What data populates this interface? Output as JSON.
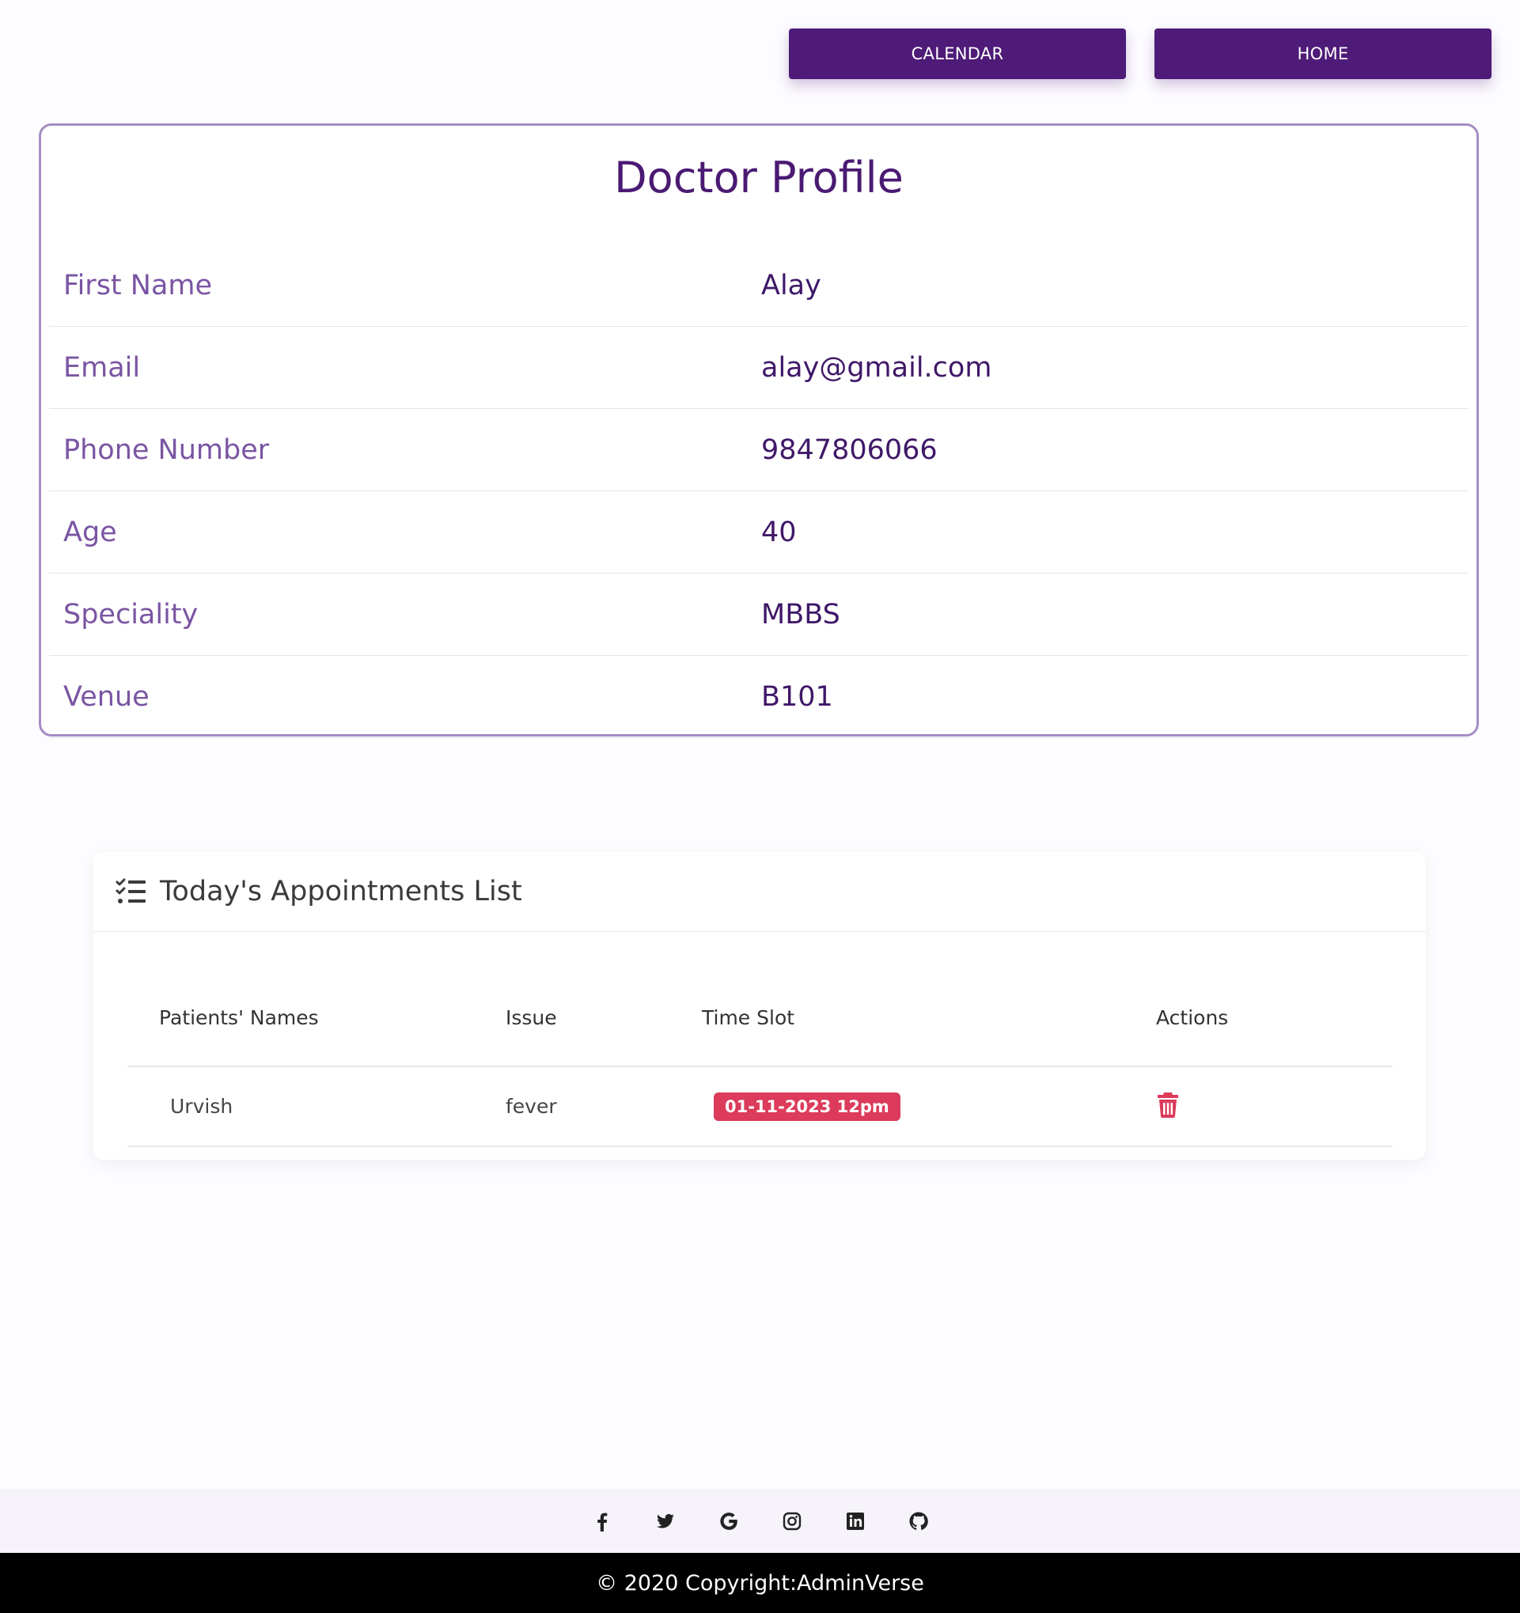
{
  "nav": {
    "calendar_label": "CALENDAR",
    "home_label": "HOME"
  },
  "profile": {
    "title": "Doctor Profile",
    "rows": [
      {
        "label": "First Name",
        "value": "Alay"
      },
      {
        "label": "Email",
        "value": "alay@gmail.com"
      },
      {
        "label": "Phone Number",
        "value": "9847806066"
      },
      {
        "label": "Age",
        "value": "40"
      },
      {
        "label": "Speciality",
        "value": "MBBS"
      },
      {
        "label": "Venue",
        "value": "B101"
      }
    ]
  },
  "appointments": {
    "title": "Today's Appointments List",
    "icon": "list-check-icon",
    "columns": [
      "Patients' Names",
      "Issue",
      "Time Slot",
      "Actions"
    ],
    "rows": [
      {
        "name": "Urvish",
        "issue": "fever",
        "time_slot": "01-11-2023 12pm",
        "action_icon": "trash-icon"
      }
    ]
  },
  "social": {
    "icons": [
      "facebook-icon",
      "twitter-icon",
      "google-icon",
      "instagram-icon",
      "linkedin-icon",
      "github-icon"
    ]
  },
  "footer": {
    "copyright": "© 2020 Copyright:AdminVerse"
  },
  "colors": {
    "primary": "#4e1b78",
    "badge": "#dc3b5b",
    "footer_bg": "#000000"
  }
}
